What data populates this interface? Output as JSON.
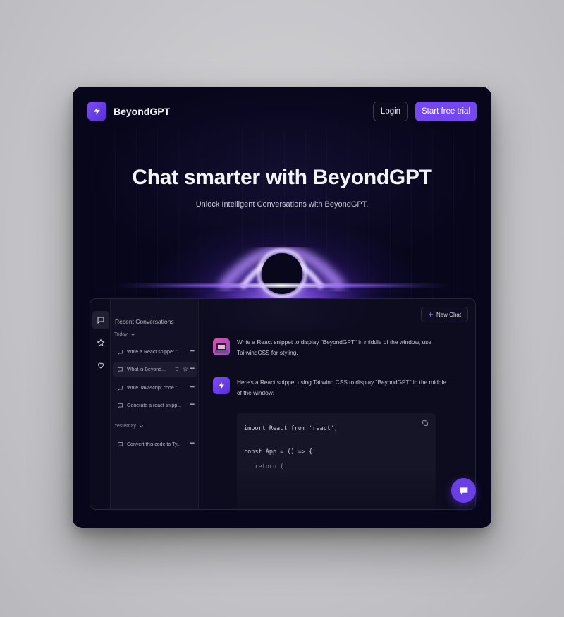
{
  "nav": {
    "brand": "BeyondGPT",
    "login_label": "Login",
    "trial_label": "Start free trial"
  },
  "hero": {
    "title": "Chat smarter with BeyondGPT",
    "subtitle": "Unlock Intelligent Conversations with BeyondGPT."
  },
  "sidebar": {
    "heading": "Recent Conversations",
    "groups": [
      {
        "label": "Today",
        "items": [
          {
            "title": "Write a React snippet t..."
          },
          {
            "title": "What is Beyond..."
          },
          {
            "title": "Write Javascript code t..."
          },
          {
            "title": "Generate a react snipp..."
          }
        ]
      },
      {
        "label": "Yesterday",
        "items": [
          {
            "title": "Convert this code to Ty..."
          }
        ]
      }
    ]
  },
  "chat": {
    "new_chat_label": "New Chat",
    "user_message": "Write a React snippet to display \"BeyondGPT\" in middle of the window, use TailwindCSS  for styling.",
    "bot_message": "Here's a React snippet using Tailwind CSS to display \"BeyondGPT\" in the middle of the window:",
    "code_lines": [
      "import React from 'react';",
      "",
      "const App = () => {",
      "   return ("
    ]
  },
  "colors": {
    "accent": "#7547f0",
    "background": "#07061a",
    "glow": "#a97bff"
  }
}
